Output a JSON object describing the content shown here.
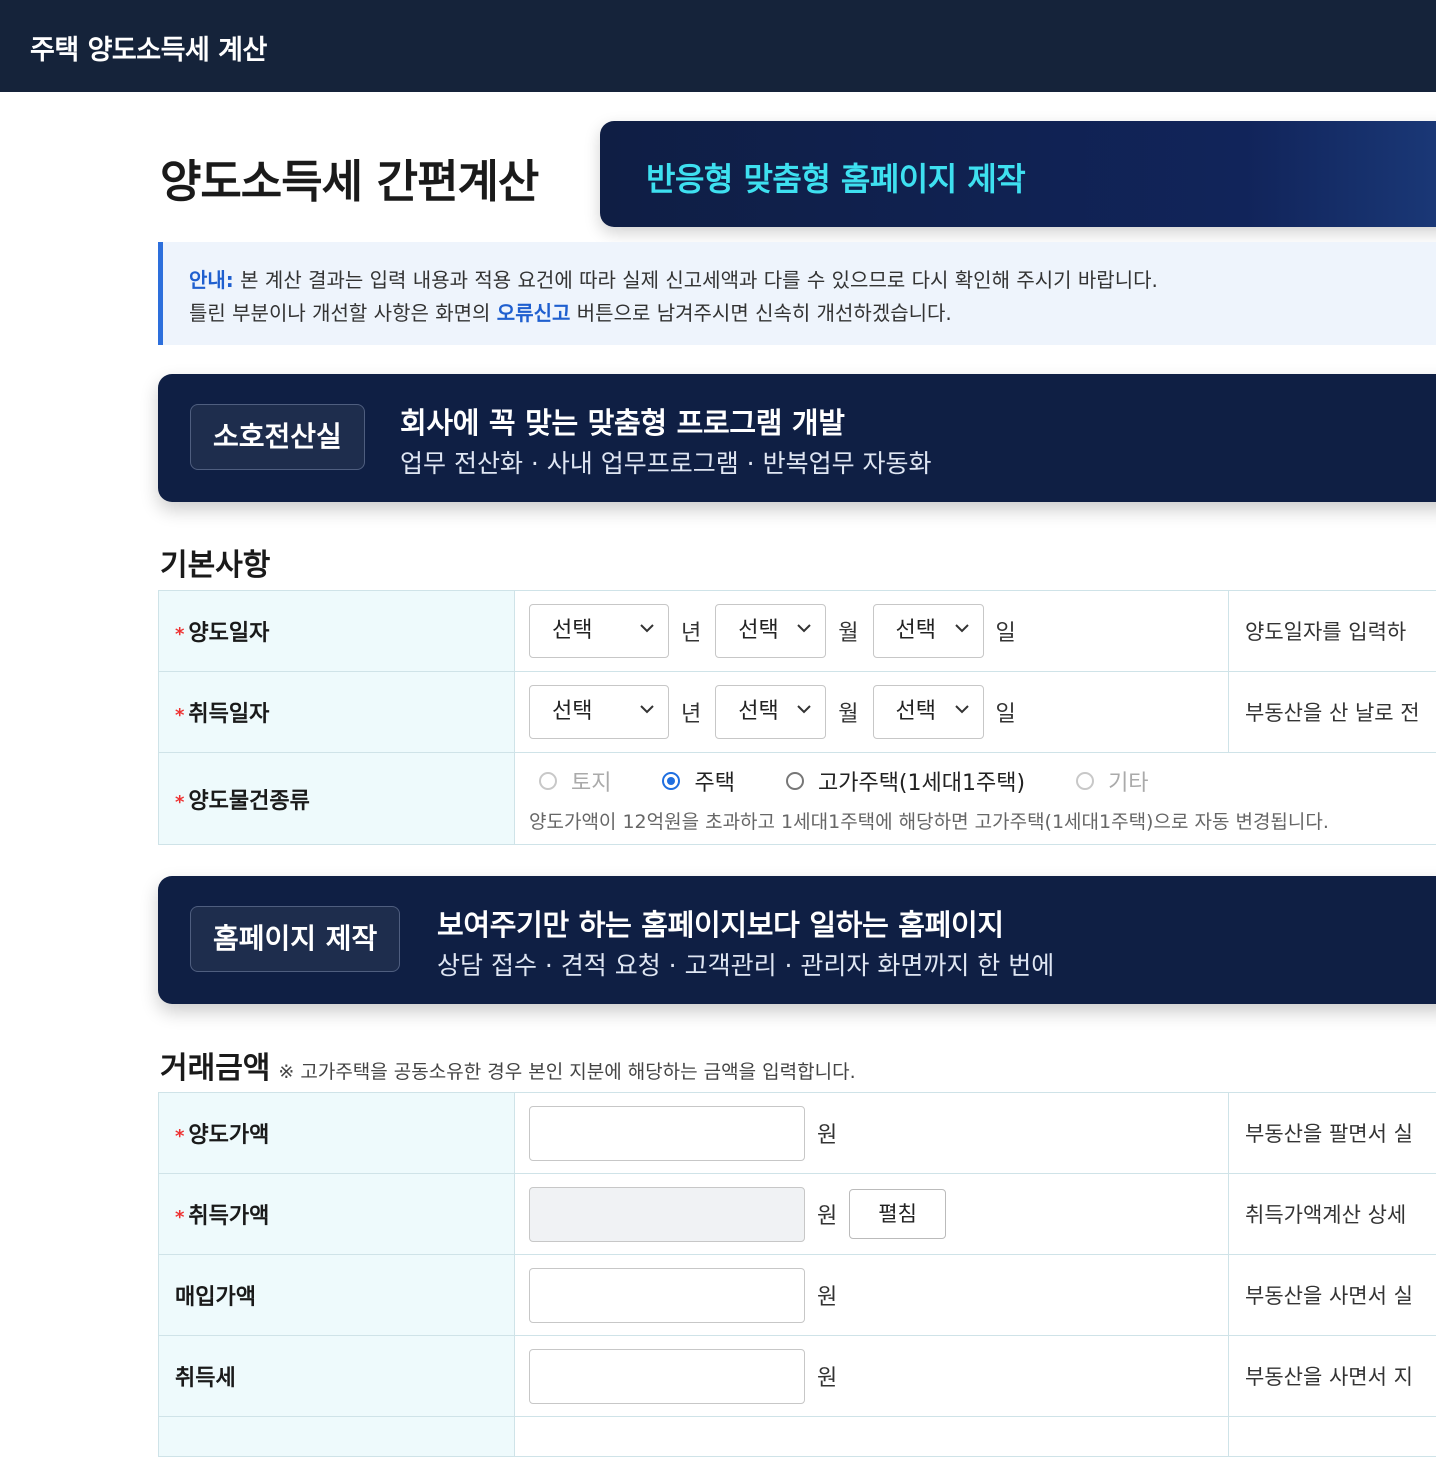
{
  "header": {
    "title": "주택 양도소득세 계산"
  },
  "page": {
    "title": "양도소득세 간편계산"
  },
  "ad_top": {
    "text": "반응형 맞춤형 홈페이지 제작"
  },
  "notice": {
    "label": "안내:",
    "line1": " 본 계산 결과는 입력 내용과 적용 요건에 따라 실제 신고세액과 다를 수 있으므로 다시 확인해 주시기 바랍니다.",
    "line2_before": "틀린 부분이나 개선할 사항은 화면의 ",
    "link": "오류신고",
    "line2_after": " 버튼으로 남겨주시면 신속히 개선하겠습니다."
  },
  "ad_banner_1": {
    "badge": "소호전산실",
    "headline": "회사에 꼭 맞는 맞춤형 프로그램 개발",
    "sub": "업무 전산화 · 사내 업무프로그램 · 반복업무 자동화"
  },
  "ad_banner_2": {
    "badge": "홈페이지 제작",
    "headline": "보여주기만 하는 홈페이지보다 일하는 홈페이지",
    "sub": "상담 접수 · 견적 요청 · 고객관리 · 관리자 화면까지 한 번에"
  },
  "section_basic": {
    "title": "기본사항",
    "required_mark": "*",
    "rows": [
      {
        "label": "양도일자",
        "year": "선택",
        "year_unit": "년",
        "month": "선택",
        "month_unit": "월",
        "day": "선택",
        "day_unit": "일",
        "help": "양도일자를 입력하"
      },
      {
        "label": "취득일자",
        "year": "선택",
        "year_unit": "년",
        "month": "선택",
        "month_unit": "월",
        "day": "선택",
        "day_unit": "일",
        "help": "부동산을 산 날로 전"
      },
      {
        "label": "양도물건종류",
        "options": [
          "토지",
          "주택",
          "고가주택(1세대1주택)",
          "기타"
        ],
        "selected": "주택",
        "note": "양도가액이 12억원을 초과하고 1세대1주택에 해당하면 고가주택(1세대1주택)으로 자동 변경됩니다."
      }
    ]
  },
  "section_amount": {
    "title": "거래금액",
    "note": "※ 고가주택을 공동소유한 경우 본인 지분에 해당하는 금액을 입력합니다.",
    "unit": "원",
    "rows": [
      {
        "label": "양도가액",
        "required": true,
        "value": "",
        "help": "부동산을 팔면서 실"
      },
      {
        "label": "취득가액",
        "required": true,
        "value": "",
        "button": "펼침",
        "help": "취득가액계산 상세"
      },
      {
        "label": "매입가액",
        "required": false,
        "value": "",
        "help": "부동산을 사면서 실"
      },
      {
        "label": "취득세",
        "required": false,
        "value": "",
        "help": "부동산을 사면서 지"
      }
    ]
  }
}
